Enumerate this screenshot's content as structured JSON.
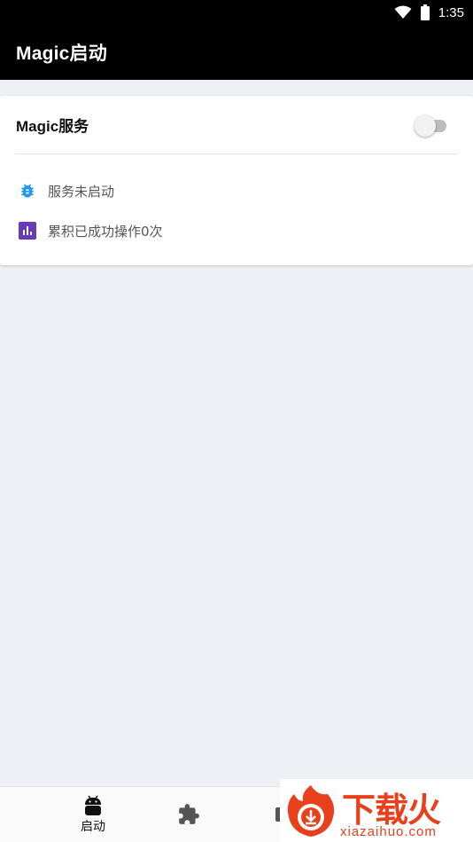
{
  "status_bar": {
    "time": "1:35",
    "wifi_icon": "wifi-icon",
    "battery_icon": "battery-icon"
  },
  "app_bar": {
    "title": "Magic启动"
  },
  "service_card": {
    "title": "Magic服务",
    "toggle_on": false,
    "rows": [
      {
        "icon": "bug-icon",
        "icon_color": "#2196f3",
        "label": "服务未启动"
      },
      {
        "icon": "bar-chart-icon",
        "icon_color": "#673ab7",
        "label": "累积已成功操作0次"
      }
    ]
  },
  "bottom_nav": {
    "items": [
      {
        "icon": "android-icon",
        "label": "启动",
        "selected": true
      },
      {
        "icon": "puzzle-icon",
        "label": "",
        "selected": false
      },
      {
        "icon": "tab-icon",
        "label": "",
        "selected": false
      }
    ]
  },
  "watermark": {
    "brand": "下载火",
    "domain": "xiazaihuo.com",
    "color": "#e8401c"
  }
}
